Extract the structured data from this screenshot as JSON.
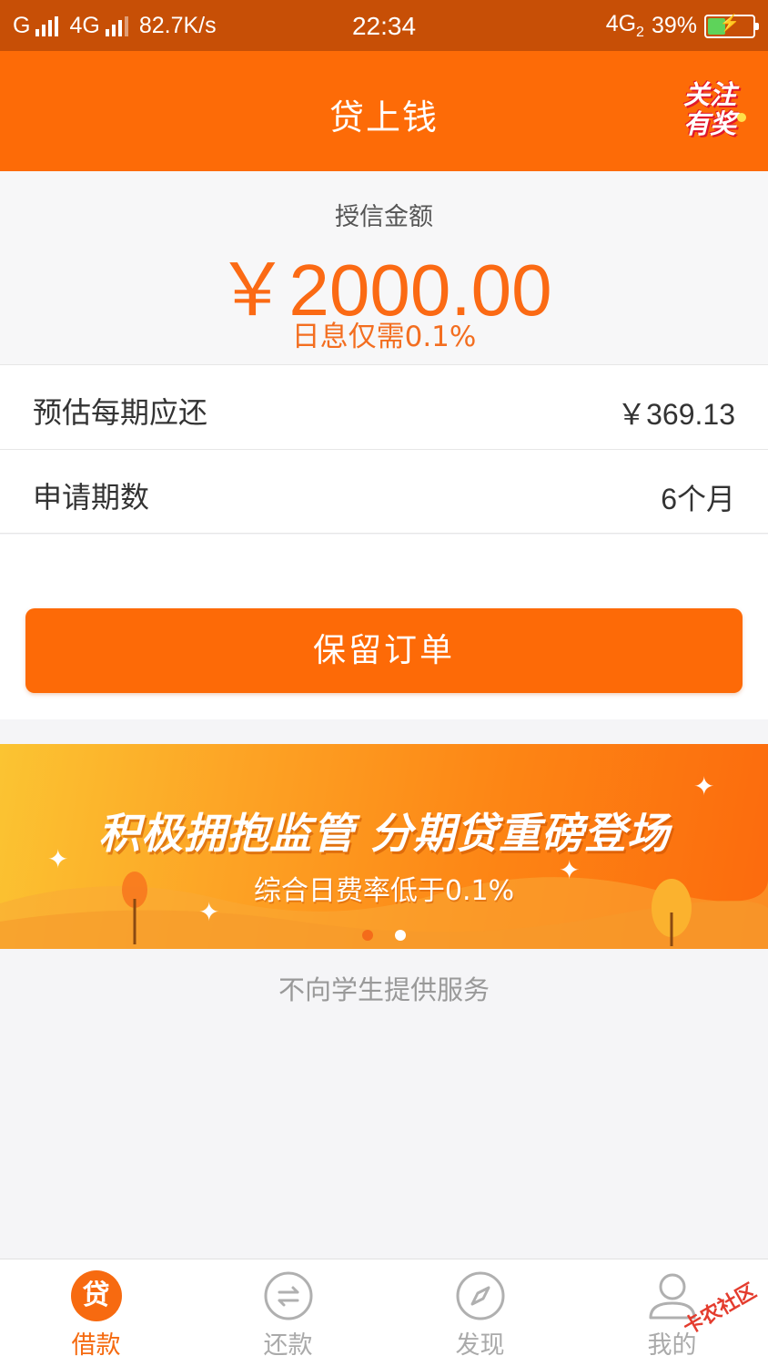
{
  "status_bar": {
    "carrier": "G",
    "network": "4G",
    "speed": "82.7K/s",
    "time": "22:34",
    "network_right": "4G",
    "network_right_sub": "2",
    "battery_percent": "39%",
    "battery_level": 0.39
  },
  "nav": {
    "title": "贷上钱",
    "reward_badge": "关注有奖"
  },
  "credit": {
    "label": "授信金额",
    "amount": "￥2000.00",
    "daily_rate": "日息仅需0.1%"
  },
  "details": [
    {
      "label": "预估每期应还",
      "value": "￥369.13"
    },
    {
      "label": "申请期数",
      "value": "6个月"
    }
  ],
  "primary_button": "保留订单",
  "banner": {
    "headline": "积极拥抱监管 分期贷重磅登场",
    "subline": "综合日费率低于0.1%",
    "slides": 2,
    "active_slide": 2
  },
  "notice": "不向学生提供服务",
  "tabs": [
    {
      "label": "借款",
      "icon": "loan-icon",
      "glyph": "贷",
      "active": true
    },
    {
      "label": "还款",
      "icon": "repay-icon",
      "active": false
    },
    {
      "label": "发现",
      "icon": "compass-icon",
      "active": false
    },
    {
      "label": "我的",
      "icon": "user-icon",
      "active": false
    }
  ],
  "watermark": "卡农社区"
}
